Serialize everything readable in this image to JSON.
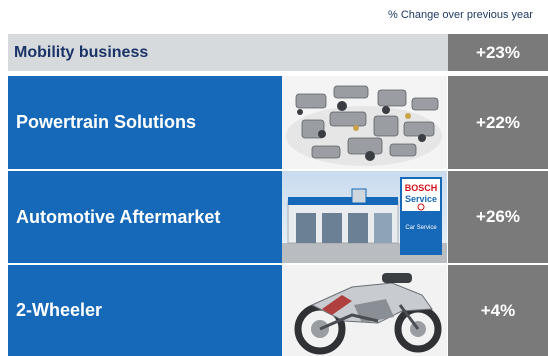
{
  "caption": "% Change over previous year",
  "header": {
    "label": "Mobility  business",
    "value": "+23%"
  },
  "segments": [
    {
      "label": "Powertrain Solutions",
      "value": "+22%",
      "image_icon": "powertrain-parts-icon"
    },
    {
      "label": "Automotive Aftermarket",
      "value": "+26%",
      "image_icon": "bosch-car-service-icon",
      "sign_text": [
        "BOSCH",
        "Service",
        "Car Service"
      ]
    },
    {
      "label": "2-Wheeler",
      "value": "+4%",
      "image_icon": "motorcycle-icon"
    }
  ],
  "colors": {
    "blue": "#1669b8",
    "gray": "#7a7a7a",
    "header_bg": "#d7dadd",
    "header_text": "#1b3467"
  }
}
